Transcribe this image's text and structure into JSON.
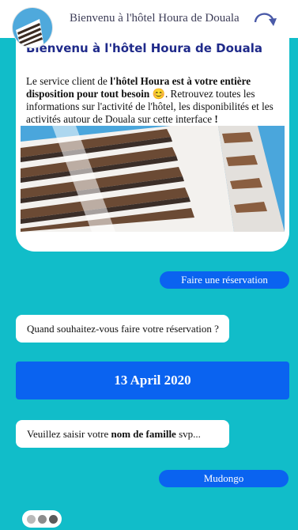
{
  "header": {
    "title": "Bienvenu à l'hôtel Houra de Douala",
    "refresh_icon": "refresh-arrow-icon"
  },
  "welcome_card": {
    "title": "Bienvenu à l'hôtel Houra de Douala",
    "text_1": "Le service client de ",
    "text_bold": "l'hôtel Houra est à votre entière disposition pour tout besoin",
    "emoji": "😊",
    "text_2": ". Retrouvez toutes les informations sur l'activité de l'hôtel, les disponibilités et les activités autour de Douala sur cette interface ",
    "text_end": "!"
  },
  "chat": {
    "reservation_button": "Faire une réservation",
    "question_date": "Quand souhaitez-vous faire votre réservation ?",
    "date_answer": "13 April 2020",
    "question_name_prefix": "Veuillez saisir votre ",
    "question_name_bold": "nom de famille",
    "question_name_suffix": " svp...",
    "name_answer": "Mudongo"
  },
  "colors": {
    "background": "#11bdc9",
    "accent": "#0a63f0",
    "title": "#1f2a8a"
  }
}
